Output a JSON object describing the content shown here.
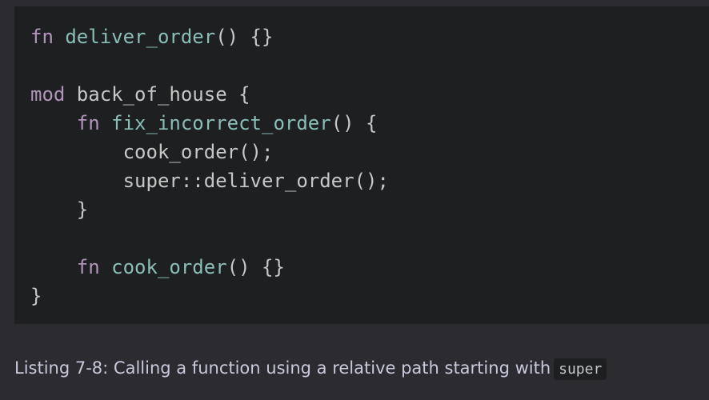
{
  "code": {
    "lines": [
      [
        {
          "t": "kw",
          "v": "fn"
        },
        {
          "t": "plain",
          "v": " "
        },
        {
          "t": "fnname",
          "v": "deliver_order"
        },
        {
          "t": "plain",
          "v": "() {}"
        }
      ],
      [],
      [
        {
          "t": "kw",
          "v": "mod"
        },
        {
          "t": "plain",
          "v": " back_of_house {"
        }
      ],
      [
        {
          "t": "plain",
          "v": "    "
        },
        {
          "t": "kw",
          "v": "fn"
        },
        {
          "t": "plain",
          "v": " "
        },
        {
          "t": "fnname",
          "v": "fix_incorrect_order"
        },
        {
          "t": "plain",
          "v": "() {"
        }
      ],
      [
        {
          "t": "plain",
          "v": "        cook_order();"
        }
      ],
      [
        {
          "t": "plain",
          "v": "        super::deliver_order();"
        }
      ],
      [
        {
          "t": "plain",
          "v": "    }"
        }
      ],
      [],
      [
        {
          "t": "plain",
          "v": "    "
        },
        {
          "t": "kw",
          "v": "fn"
        },
        {
          "t": "plain",
          "v": " "
        },
        {
          "t": "fnname",
          "v": "cook_order"
        },
        {
          "t": "plain",
          "v": "() {}"
        }
      ],
      [
        {
          "t": "plain",
          "v": "}"
        }
      ]
    ]
  },
  "caption": {
    "text": "Listing 7-8: Calling a function using a relative path starting with",
    "code": "super"
  }
}
